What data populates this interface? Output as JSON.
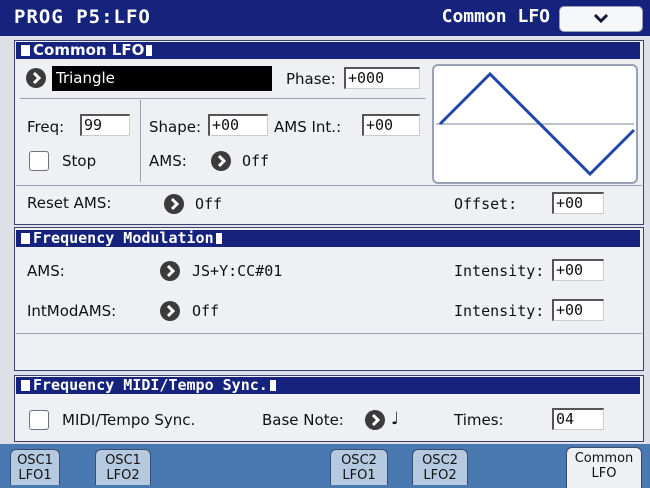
{
  "header": {
    "title": "PROG P5:LFO",
    "page": "Common LFO",
    "menu_icon": "chevron-down-icon"
  },
  "common_lfo": {
    "title": "Common LFO",
    "waveform": "Triangle",
    "phase_label": "Phase:",
    "phase_value": "+000",
    "freq_label": "Freq:",
    "freq_value": "99",
    "shape_label": "Shape:",
    "shape_value": "+00",
    "ams_int_label": "AMS Int.:",
    "ams_int_value": "+00",
    "stop_label": "Stop",
    "stop_checked": false,
    "ams_label": "AMS:",
    "ams_value": "Off",
    "reset_ams_label": "Reset AMS:",
    "reset_ams_value": "Off",
    "offset_label": "Offset:",
    "offset_value": "+00"
  },
  "freq_mod": {
    "title": "Frequency Modulation",
    "ams_label": "AMS:",
    "ams_value": "JS+Y:CC#01",
    "intensity1_label": "Intensity:",
    "intensity1_value": "+00",
    "intmod_label": "IntModAMS:",
    "intmod_value": "Off",
    "intensity2_label": "Intensity:",
    "intensity2_value": "+00"
  },
  "midi_sync": {
    "title": "Frequency MIDI/Tempo Sync.",
    "sync_label": "MIDI/Tempo Sync.",
    "sync_checked": false,
    "base_note_label": "Base Note:",
    "base_note_value": "♩",
    "times_label": "Times:",
    "times_value": "04"
  },
  "tabs": [
    {
      "line1": "OSC1",
      "line2": "LFO1"
    },
    {
      "line1": "OSC1",
      "line2": "LFO2"
    },
    {
      "line1": "OSC2",
      "line2": "LFO1"
    },
    {
      "line1": "OSC2",
      "line2": "LFO2"
    },
    {
      "line1": "Common",
      "line2": "LFO",
      "active": true
    }
  ],
  "colors": {
    "header": "#15237c",
    "tab_bar": "#4a78b0",
    "tab": "#b5c9e0",
    "waveform": "#1f46a8"
  }
}
